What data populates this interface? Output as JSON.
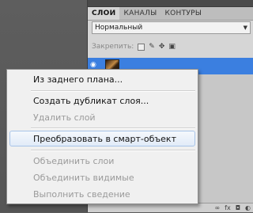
{
  "layers_panel": {
    "tabs": [
      {
        "label": "СЛОИ",
        "active": true
      },
      {
        "label": "КАНАЛЫ",
        "active": false
      },
      {
        "label": "КОНТУРЫ",
        "active": false
      }
    ],
    "blend_mode": "Нормальный",
    "lock_label": "Закрепить:"
  },
  "context_menu": {
    "items": [
      {
        "label": "Из заднего плана...",
        "enabled": true
      },
      {
        "label": "Создать дубликат слоя...",
        "enabled": true
      },
      {
        "label": "Удалить слой",
        "enabled": false
      },
      {
        "label": "Преобразовать в смарт-объект",
        "enabled": true,
        "highlighted": true
      },
      {
        "label": "Объединить слои",
        "enabled": false
      },
      {
        "label": "Объединить видимые",
        "enabled": false
      },
      {
        "label": "Выполнить сведение",
        "enabled": false
      }
    ]
  },
  "colors": {
    "selected_layer": "#3b7fe0",
    "menu_bg": "#f0f0f0",
    "highlight_border": "#a8c4e8",
    "disabled_text": "#9a9a9a"
  }
}
